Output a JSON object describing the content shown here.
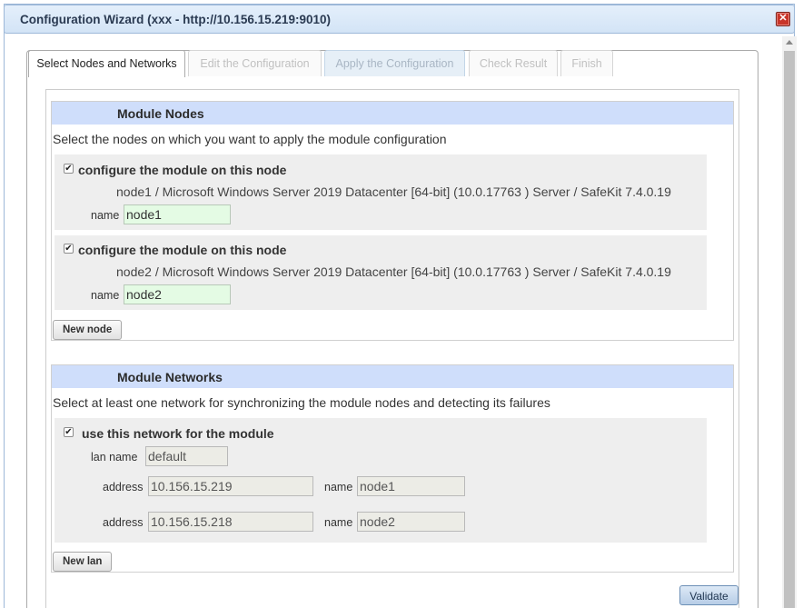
{
  "window": {
    "title": "Configuration Wizard (xxx - http://10.156.15.219:9010)",
    "close_icon": "close-icon"
  },
  "tabs": [
    {
      "label": "Select Nodes and Networks",
      "state": "active"
    },
    {
      "label": "Edit the Configuration",
      "state": "disabled"
    },
    {
      "label": "Apply the Configuration",
      "state": "highlighted"
    },
    {
      "label": "Check Result",
      "state": "disabled"
    },
    {
      "label": "Finish",
      "state": "disabled"
    }
  ],
  "module_nodes": {
    "title": "Module Nodes",
    "instruction": "Select the nodes on which you want to apply the module configuration",
    "nodes": [
      {
        "checked": true,
        "check_label": "configure the module on this node",
        "info": "node1 / Microsoft Windows Server 2019 Datacenter [64-bit] (10.0.17763 ) Server / SafeKit 7.4.0.19",
        "name_label": "name",
        "name_value": "node1"
      },
      {
        "checked": true,
        "check_label": "configure the module on this node",
        "info": "node2 / Microsoft Windows Server 2019 Datacenter [64-bit] (10.0.17763 ) Server / SafeKit 7.4.0.19",
        "name_label": "name",
        "name_value": "node2"
      }
    ],
    "new_node_label": "New node"
  },
  "module_networks": {
    "title": "Module Networks",
    "instruction": "Select at least one network for synchronizing the module nodes and detecting its failures",
    "lan": {
      "checked": true,
      "check_label": "use this network for the module",
      "lan_name_label": "lan name",
      "lan_name_value": "default",
      "addresses": [
        {
          "address_label": "address",
          "address_value": "10.156.15.219",
          "name_label": "name",
          "name_value": "node1"
        },
        {
          "address_label": "address",
          "address_value": "10.156.15.218",
          "name_label": "name",
          "name_value": "node2"
        }
      ]
    },
    "new_lan_label": "New lan"
  },
  "validate_label": "Validate",
  "check_mark": "✔"
}
